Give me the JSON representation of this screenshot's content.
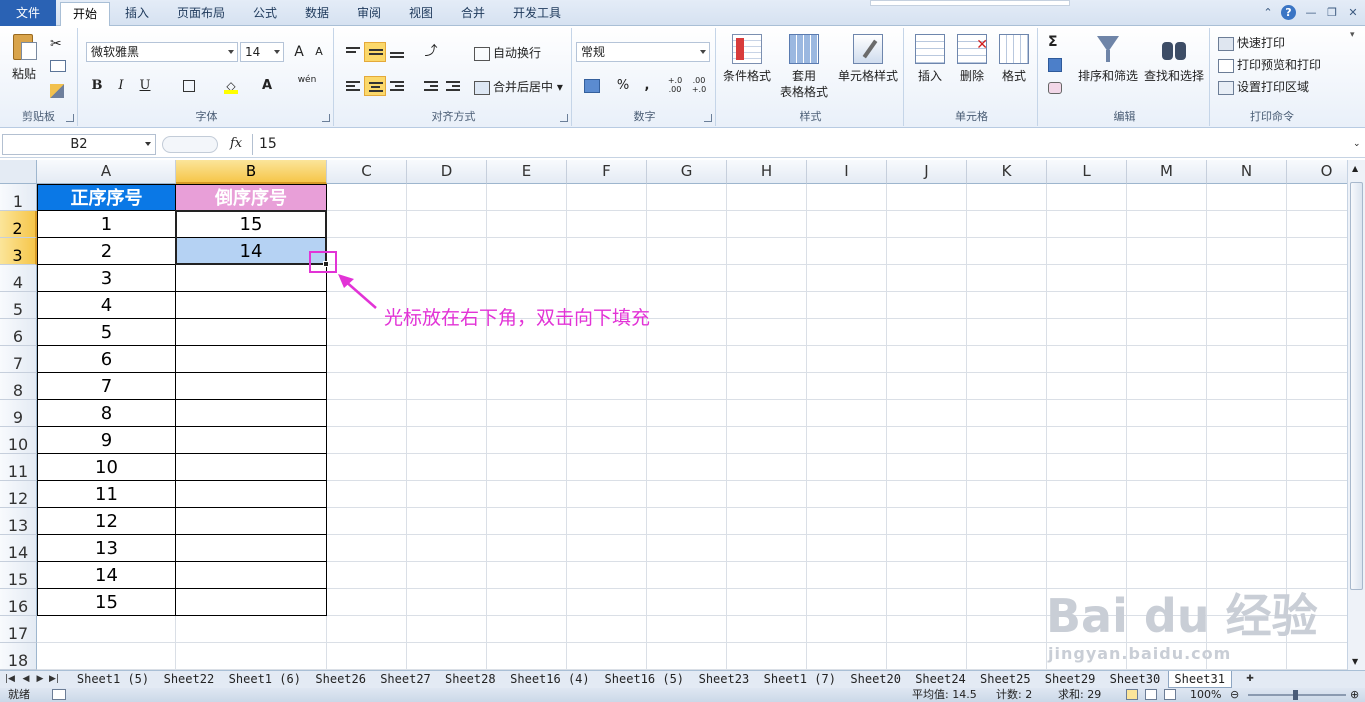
{
  "tabs": [
    "文件",
    "开始",
    "插入",
    "页面布局",
    "公式",
    "数据",
    "审阅",
    "视图",
    "合并",
    "开发工具"
  ],
  "ribbon": {
    "clipboard": {
      "paste": "粘贴",
      "label": "剪贴板"
    },
    "font": {
      "name": "微软雅黑",
      "size": "14",
      "grow": "A",
      "shrink": "A",
      "bold": "B",
      "italic": "I",
      "underline": "U",
      "label": "字体",
      "wen": "wén"
    },
    "alignment": {
      "wrap": "自动换行",
      "merge": "合并后居中",
      "label": "对齐方式"
    },
    "number": {
      "format": "常规",
      "percent": "%",
      "comma": ",",
      "inc": "+.0 .00",
      "dec": ".00 +.0",
      "label": "数字"
    },
    "styles": {
      "conditional": "条件格式",
      "table_line1": "套用",
      "table_line2": "表格格式",
      "cell_style": "单元格样式",
      "label": "样式"
    },
    "cells": {
      "insert": "插入",
      "delete": "删除",
      "format": "格式",
      "label": "单元格"
    },
    "editing": {
      "sigma": "Σ",
      "sort": "排序和筛选",
      "find": "查找和选择",
      "label": "编辑"
    },
    "print": {
      "quick": "快速打印",
      "preview": "打印预览和打印",
      "area": "设置打印区域",
      "label": "打印命令"
    }
  },
  "formula_bar": {
    "name_box": "B2",
    "fx": "fx",
    "value": "15"
  },
  "columns": [
    "A",
    "B",
    "C",
    "D",
    "E",
    "F",
    "G",
    "H",
    "I",
    "J",
    "K",
    "L",
    "M",
    "N",
    "O"
  ],
  "rows": [
    "1",
    "2",
    "3",
    "4",
    "5",
    "6",
    "7",
    "8",
    "9",
    "10",
    "11",
    "12",
    "13",
    "14",
    "15",
    "16",
    "17",
    "18"
  ],
  "table": {
    "header_a": "正序序号",
    "header_b": "倒序序号",
    "col_a": [
      "1",
      "2",
      "3",
      "4",
      "5",
      "6",
      "7",
      "8",
      "9",
      "10",
      "11",
      "12",
      "13",
      "14",
      "15"
    ],
    "col_b": [
      "15",
      "14"
    ]
  },
  "annotation": "光标放在右下角，双击向下填充",
  "sheets": [
    "Sheet1 (5)",
    "Sheet22",
    "Sheet1 (6)",
    "Sheet26",
    "Sheet27",
    "Sheet28",
    "Sheet16 (4)",
    "Sheet16 (5)",
    "Sheet23",
    "Sheet1 (7)",
    "Sheet20",
    "Sheet24",
    "Sheet25",
    "Sheet29",
    "Sheet30",
    "Sheet31"
  ],
  "status": {
    "ready": "就绪",
    "average": "平均值: 14.5",
    "count": "计数: 2",
    "sum": "求和: 29",
    "zoom": "100%"
  },
  "watermark": {
    "brand": "Bai du 经验",
    "url": "jingyan.baidu.com"
  },
  "colors": {
    "accent_blue": "#0a78e6",
    "header_pink": "#e89fd8",
    "annotation": "#e233d6",
    "selection": "#b5d2f3"
  }
}
